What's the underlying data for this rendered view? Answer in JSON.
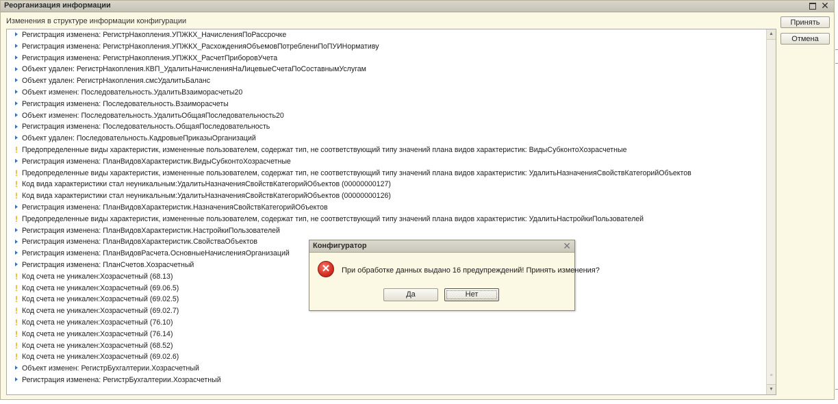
{
  "window": {
    "title": "Реорганизация информации",
    "section_label": "Изменения в структуре информации конфигурации",
    "accept_label": "Принять",
    "cancel_label": "Отмена",
    "maximize_icon": "maximize-icon",
    "close_glyph": "✕"
  },
  "changes": [
    {
      "kind": "arrow",
      "text": "Регистрация изменена: РегистрНакопления.УПЖКХ_НачисленияПоРассрочке"
    },
    {
      "kind": "arrow",
      "text": "Регистрация изменена: РегистрНакопления.УПЖКХ_РасхожденияОбъемовПотреблениПоПУИНормативу"
    },
    {
      "kind": "arrow",
      "text": "Регистрация изменена: РегистрНакопления.УПЖКХ_РасчетПриборовУчета"
    },
    {
      "kind": "arrow",
      "text": "Объект удален: РегистрНакопления.КВП_УдалитьНачисленияНаЛицевыеСчетаПоСоставнымУслугам"
    },
    {
      "kind": "arrow",
      "text": "Объект удален: РегистрНакопления.смсУдалитьБаланс"
    },
    {
      "kind": "arrow",
      "text": "Объект изменен: Последовательность.УдалитьВзаиморасчеты20"
    },
    {
      "kind": "arrow",
      "text": "Регистрация изменена: Последовательность.Взаиморасчеты"
    },
    {
      "kind": "arrow",
      "text": "Объект изменен: Последовательность.УдалитьОбщаяПоследовательность20"
    },
    {
      "kind": "arrow",
      "text": "Регистрация изменена: Последовательность.ОбщаяПоследовательность"
    },
    {
      "kind": "arrow",
      "text": "Объект удален: Последовательность.КадровыеПриказыОрганизаций"
    },
    {
      "kind": "warn",
      "text": "Предопределенные виды характеристик, измененные пользователем, содержат тип, не соответствующий типу значений плана видов характеристик: ВидыСубконтоХозрасчетные"
    },
    {
      "kind": "arrow",
      "text": "Регистрация изменена: ПланВидовХарактеристик.ВидыСубконтоХозрасчетные"
    },
    {
      "kind": "warn",
      "text": "Предопределенные виды характеристик, измененные пользователем, содержат тип, не соответствующий типу значений плана видов характеристик: УдалитьНазначенияСвойствКатегорийОбъектов"
    },
    {
      "kind": "warn",
      "text": "Код вида характеристики стал неуникальным:УдалитьНазначенияСвойствКатегорийОбъектов (00000000127)"
    },
    {
      "kind": "warn",
      "text": "Код вида характеристики стал неуникальным:УдалитьНазначенияСвойствКатегорийОбъектов (00000000126)"
    },
    {
      "kind": "arrow",
      "text": "Регистрация изменена: ПланВидовХарактеристик.НазначенияСвойствКатегорийОбъектов"
    },
    {
      "kind": "warn",
      "text": "Предопределенные виды характеристик, измененные пользователем, содержат тип, не соответствующий типу значений плана видов характеристик: УдалитьНастройкиПользователей"
    },
    {
      "kind": "arrow",
      "text": "Регистрация изменена: ПланВидовХарактеристик.НастройкиПользователей"
    },
    {
      "kind": "arrow",
      "text": "Регистрация изменена: ПланВидовХарактеристик.СвойстваОбъектов"
    },
    {
      "kind": "arrow",
      "text": "Регистрация изменена: ПланВидовРасчета.ОсновныеНачисленияОрганизаций"
    },
    {
      "kind": "arrow",
      "text": "Регистрация изменена: ПланСчетов.Хозрасчетный"
    },
    {
      "kind": "warn",
      "text": "Код счета не уникален:Хозрасчетный (68.13)"
    },
    {
      "kind": "warn",
      "text": "Код счета не уникален:Хозрасчетный (69.06.5)"
    },
    {
      "kind": "warn",
      "text": "Код счета не уникален:Хозрасчетный (69.02.5)"
    },
    {
      "kind": "warn",
      "text": "Код счета не уникален:Хозрасчетный (69.02.7)"
    },
    {
      "kind": "warn",
      "text": "Код счета не уникален:Хозрасчетный (76.10)"
    },
    {
      "kind": "warn",
      "text": "Код счета не уникален:Хозрасчетный (76.14)"
    },
    {
      "kind": "warn",
      "text": "Код счета не уникален:Хозрасчетный (68.52)"
    },
    {
      "kind": "warn",
      "text": "Код счета не уникален:Хозрасчетный (69.02.6)"
    },
    {
      "kind": "arrow",
      "text": "Объект изменен: РегистрБухгалтерии.Хозрасчетный"
    },
    {
      "kind": "arrow",
      "text": "Регистрация изменена: РегистрБухгалтерии.Хозрасчетный"
    }
  ],
  "dialog": {
    "title": "Конфигуратор",
    "message": "При обработке данных выдано 16 предупреждений! Принять изменения?",
    "yes_label": "Да",
    "no_label": "Нет",
    "icon": "error-icon",
    "close_glyph": "✕"
  },
  "colors": {
    "background": "#fbf8e3",
    "arrow": "#3b6fb0",
    "warning": "#e8b300",
    "error": "#d32f23"
  }
}
